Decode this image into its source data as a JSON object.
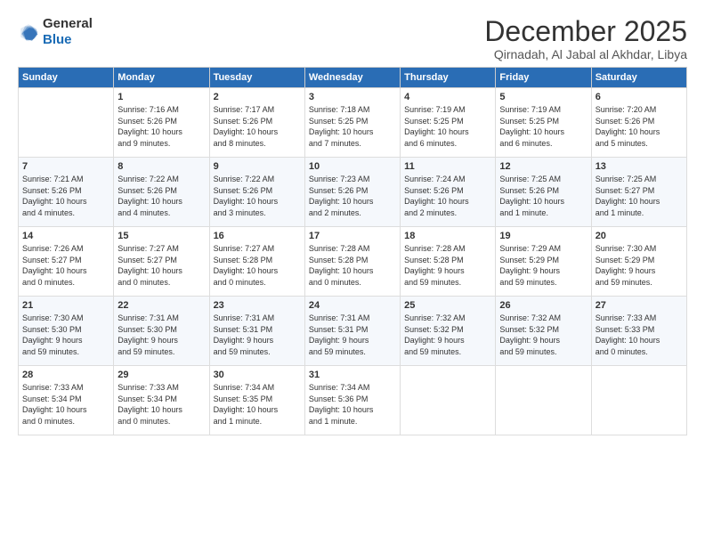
{
  "logo": {
    "general": "General",
    "blue": "Blue"
  },
  "title": "December 2025",
  "subtitle": "Qirnadah, Al Jabal al Akhdar, Libya",
  "days_header": [
    "Sunday",
    "Monday",
    "Tuesday",
    "Wednesday",
    "Thursday",
    "Friday",
    "Saturday"
  ],
  "weeks": [
    [
      {
        "day": "",
        "info": ""
      },
      {
        "day": "1",
        "info": "Sunrise: 7:16 AM\nSunset: 5:26 PM\nDaylight: 10 hours\nand 9 minutes."
      },
      {
        "day": "2",
        "info": "Sunrise: 7:17 AM\nSunset: 5:26 PM\nDaylight: 10 hours\nand 8 minutes."
      },
      {
        "day": "3",
        "info": "Sunrise: 7:18 AM\nSunset: 5:25 PM\nDaylight: 10 hours\nand 7 minutes."
      },
      {
        "day": "4",
        "info": "Sunrise: 7:19 AM\nSunset: 5:25 PM\nDaylight: 10 hours\nand 6 minutes."
      },
      {
        "day": "5",
        "info": "Sunrise: 7:19 AM\nSunset: 5:25 PM\nDaylight: 10 hours\nand 6 minutes."
      },
      {
        "day": "6",
        "info": "Sunrise: 7:20 AM\nSunset: 5:26 PM\nDaylight: 10 hours\nand 5 minutes."
      }
    ],
    [
      {
        "day": "7",
        "info": "Sunrise: 7:21 AM\nSunset: 5:26 PM\nDaylight: 10 hours\nand 4 minutes."
      },
      {
        "day": "8",
        "info": "Sunrise: 7:22 AM\nSunset: 5:26 PM\nDaylight: 10 hours\nand 4 minutes."
      },
      {
        "day": "9",
        "info": "Sunrise: 7:22 AM\nSunset: 5:26 PM\nDaylight: 10 hours\nand 3 minutes."
      },
      {
        "day": "10",
        "info": "Sunrise: 7:23 AM\nSunset: 5:26 PM\nDaylight: 10 hours\nand 2 minutes."
      },
      {
        "day": "11",
        "info": "Sunrise: 7:24 AM\nSunset: 5:26 PM\nDaylight: 10 hours\nand 2 minutes."
      },
      {
        "day": "12",
        "info": "Sunrise: 7:25 AM\nSunset: 5:26 PM\nDaylight: 10 hours\nand 1 minute."
      },
      {
        "day": "13",
        "info": "Sunrise: 7:25 AM\nSunset: 5:27 PM\nDaylight: 10 hours\nand 1 minute."
      }
    ],
    [
      {
        "day": "14",
        "info": "Sunrise: 7:26 AM\nSunset: 5:27 PM\nDaylight: 10 hours\nand 0 minutes."
      },
      {
        "day": "15",
        "info": "Sunrise: 7:27 AM\nSunset: 5:27 PM\nDaylight: 10 hours\nand 0 minutes."
      },
      {
        "day": "16",
        "info": "Sunrise: 7:27 AM\nSunset: 5:28 PM\nDaylight: 10 hours\nand 0 minutes."
      },
      {
        "day": "17",
        "info": "Sunrise: 7:28 AM\nSunset: 5:28 PM\nDaylight: 10 hours\nand 0 minutes."
      },
      {
        "day": "18",
        "info": "Sunrise: 7:28 AM\nSunset: 5:28 PM\nDaylight: 9 hours\nand 59 minutes."
      },
      {
        "day": "19",
        "info": "Sunrise: 7:29 AM\nSunset: 5:29 PM\nDaylight: 9 hours\nand 59 minutes."
      },
      {
        "day": "20",
        "info": "Sunrise: 7:30 AM\nSunset: 5:29 PM\nDaylight: 9 hours\nand 59 minutes."
      }
    ],
    [
      {
        "day": "21",
        "info": "Sunrise: 7:30 AM\nSunset: 5:30 PM\nDaylight: 9 hours\nand 59 minutes."
      },
      {
        "day": "22",
        "info": "Sunrise: 7:31 AM\nSunset: 5:30 PM\nDaylight: 9 hours\nand 59 minutes."
      },
      {
        "day": "23",
        "info": "Sunrise: 7:31 AM\nSunset: 5:31 PM\nDaylight: 9 hours\nand 59 minutes."
      },
      {
        "day": "24",
        "info": "Sunrise: 7:31 AM\nSunset: 5:31 PM\nDaylight: 9 hours\nand 59 minutes."
      },
      {
        "day": "25",
        "info": "Sunrise: 7:32 AM\nSunset: 5:32 PM\nDaylight: 9 hours\nand 59 minutes."
      },
      {
        "day": "26",
        "info": "Sunrise: 7:32 AM\nSunset: 5:32 PM\nDaylight: 9 hours\nand 59 minutes."
      },
      {
        "day": "27",
        "info": "Sunrise: 7:33 AM\nSunset: 5:33 PM\nDaylight: 10 hours\nand 0 minutes."
      }
    ],
    [
      {
        "day": "28",
        "info": "Sunrise: 7:33 AM\nSunset: 5:34 PM\nDaylight: 10 hours\nand 0 minutes."
      },
      {
        "day": "29",
        "info": "Sunrise: 7:33 AM\nSunset: 5:34 PM\nDaylight: 10 hours\nand 0 minutes."
      },
      {
        "day": "30",
        "info": "Sunrise: 7:34 AM\nSunset: 5:35 PM\nDaylight: 10 hours\nand 1 minute."
      },
      {
        "day": "31",
        "info": "Sunrise: 7:34 AM\nSunset: 5:36 PM\nDaylight: 10 hours\nand 1 minute."
      },
      {
        "day": "",
        "info": ""
      },
      {
        "day": "",
        "info": ""
      },
      {
        "day": "",
        "info": ""
      }
    ]
  ]
}
